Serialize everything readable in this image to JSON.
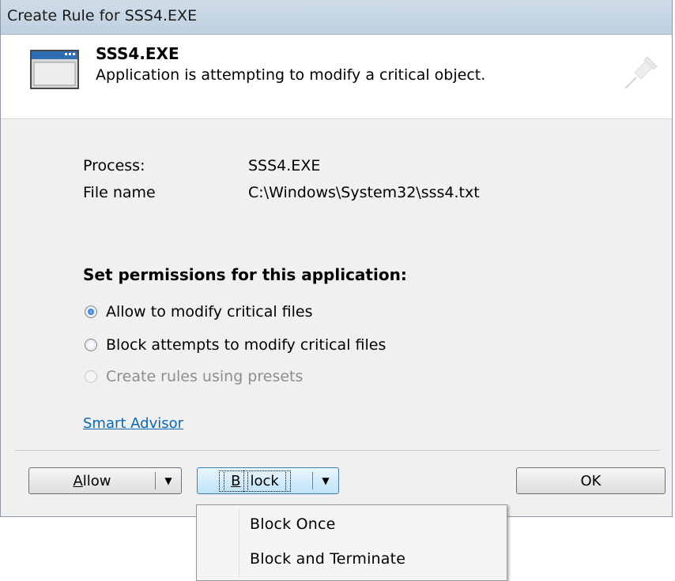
{
  "window": {
    "title": "Create Rule for SSS4.EXE"
  },
  "header": {
    "app_name": "SSS4.EXE",
    "description": "Application is attempting to modify a critical object."
  },
  "info": {
    "process_label": "Process:",
    "process_value": "SSS4.EXE",
    "file_label": "File name",
    "file_value": "C:\\Windows\\System32\\sss4.txt"
  },
  "permissions": {
    "title": "Set permissions for this application:",
    "options": [
      {
        "label": "Allow to modify critical files",
        "selected": true,
        "enabled": true
      },
      {
        "label": "Block attempts to modify critical files",
        "selected": false,
        "enabled": true
      },
      {
        "label": "Create rules using presets",
        "selected": false,
        "enabled": false
      }
    ]
  },
  "links": {
    "smart_advisor": "Smart Advisor"
  },
  "buttons": {
    "allow_first": "A",
    "allow_rest": "llow",
    "block_first": "B",
    "block_rest": "lock",
    "ok": "OK"
  },
  "dropdown": {
    "items": [
      "Block Once",
      "Block and Terminate"
    ]
  },
  "icons": {
    "app": "application-window-icon",
    "pin": "pushpin-icon",
    "arrow": "chevron-down-icon"
  }
}
